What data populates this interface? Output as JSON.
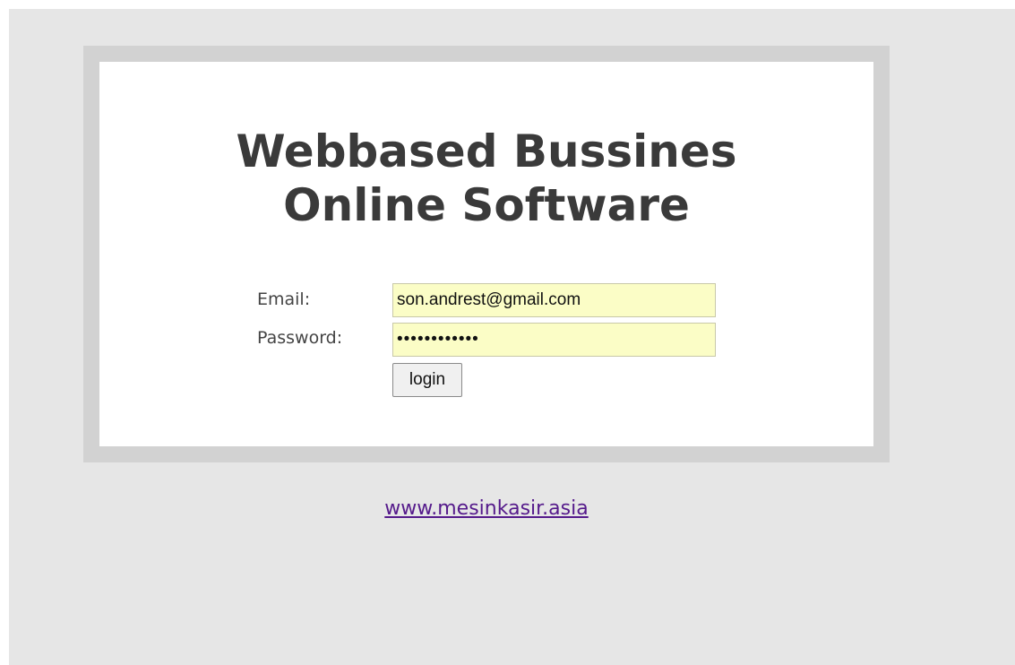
{
  "title": {
    "line1": "Webbased Bussines",
    "line2": "Online Software"
  },
  "form": {
    "email_label": "Email:",
    "email_value": "son.andrest@gmail.com",
    "password_label": "Password:",
    "password_value": "••••••••••••",
    "login_label": "login"
  },
  "footer": {
    "link_text": "www.mesinkasir.asia"
  },
  "colors": {
    "background": "#e6e6e6",
    "frame": "#d2d2d2",
    "card": "#ffffff",
    "input_fill": "#fbfdc6",
    "title_text": "#3a3a3a",
    "link_visited": "#551a8b"
  }
}
